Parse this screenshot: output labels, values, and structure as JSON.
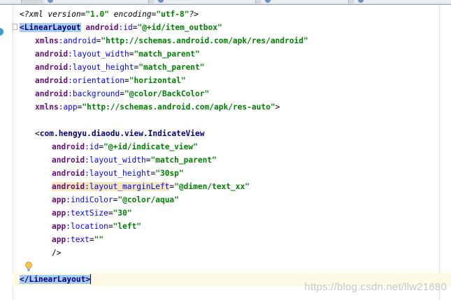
{
  "editor": {
    "colors": {
      "tag": "#000080",
      "attribute_namespace": "#660e7a",
      "attribute_name": "#0000ff",
      "attribute_value": "#008000",
      "tag_highlight": "#a8cdef",
      "caret_line": "#fffae3"
    },
    "lines": {
      "l01": {
        "pre": "<?xml version=",
        "v1": "\"1.0\"",
        "mid": " encoding=",
        "v2": "\"utf-8\"",
        "post": "?>"
      },
      "l02": {
        "open": "<",
        "tag": "LinearLayout",
        "ns": " android",
        "colon": ":",
        "attr": "id",
        "eq": "=",
        "val": "\"@+id/item_outbox\""
      },
      "l03": {
        "ns": "xmlns",
        "colon": ":",
        "attr": "android",
        "eq": "=",
        "val": "\"http://schemas.android.com/apk/res/android\""
      },
      "l04": {
        "ns": "android",
        "colon": ":",
        "attr": "layout_width",
        "eq": "=",
        "val": "\"match_parent\""
      },
      "l05": {
        "ns": "android",
        "colon": ":",
        "attr": "layout_height",
        "eq": "=",
        "val": "\"match_parent\""
      },
      "l06": {
        "ns": "android",
        "colon": ":",
        "attr": "orientation",
        "eq": "=",
        "val": "\"horizontal\""
      },
      "l07": {
        "ns": "android",
        "colon": ":",
        "attr": "background",
        "eq": "=",
        "val": "\"@color/BackColor\""
      },
      "l08": {
        "ns": "xmlns",
        "colon": ":",
        "attr": "app",
        "eq": "=",
        "val": "\"http://schemas.android.com/apk/res-auto\"",
        "close": ">"
      },
      "l10": {
        "open": "<",
        "tag": "com.hengyu.diaodu.view.IndicateView"
      },
      "l11": {
        "ns": "android",
        "colon": ":",
        "attr": "id",
        "eq": "=",
        "val": "\"@+id/indicate_view\""
      },
      "l12": {
        "ns": "android",
        "colon": ":",
        "attr": "layout_width",
        "eq": "=",
        "val": "\"match_parent\""
      },
      "l13": {
        "ns": "android",
        "colon": ":",
        "attr": "layout_height",
        "eq": "=",
        "val": "\"30sp\""
      },
      "l14": {
        "ns": "android",
        "colon": ":",
        "attr": "layout_marginLeft",
        "eq": "=",
        "val": "\"@dimen/text_xx\""
      },
      "l15": {
        "ns": "app",
        "colon": ":",
        "attr": "indiColor",
        "eq": "=",
        "val": "\"@color/aqua\""
      },
      "l16": {
        "ns": "app",
        "colon": ":",
        "attr": "textSize",
        "eq": "=",
        "val": "\"30\""
      },
      "l17": {
        "ns": "app",
        "colon": ":",
        "attr": "location",
        "eq": "=",
        "val": "\"left\""
      },
      "l18": {
        "ns": "app",
        "colon": ":",
        "attr": "text",
        "eq": "=",
        "val": "\"\""
      },
      "l19": {
        "close": "/>"
      },
      "l21": {
        "open": "</",
        "tag": "LinearLayout",
        "close": ">"
      }
    }
  },
  "watermark": "https://blog.csdn.net/llw21680"
}
